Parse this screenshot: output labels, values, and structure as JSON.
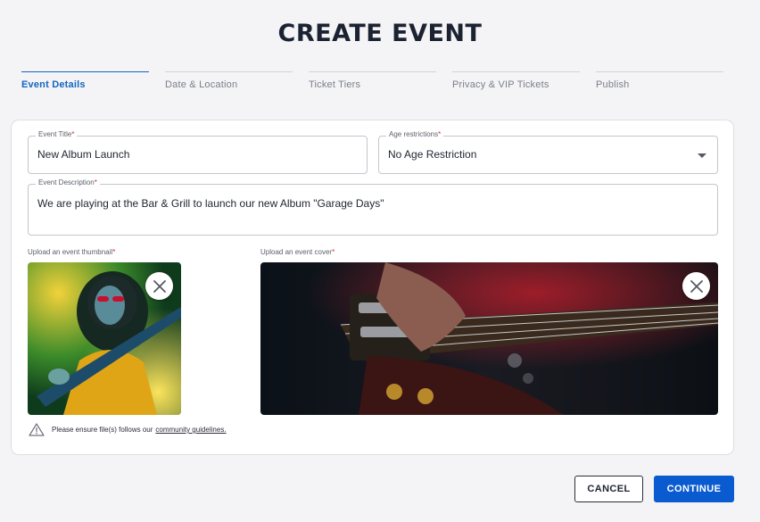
{
  "page": {
    "title": "CREATE EVENT"
  },
  "stepper": {
    "steps": [
      {
        "label": "Event Details",
        "active": true
      },
      {
        "label": "Date & Location",
        "active": false
      },
      {
        "label": "Ticket Tiers",
        "active": false
      },
      {
        "label": "Privacy & VIP Tickets",
        "active": false
      },
      {
        "label": "Publish",
        "active": false
      }
    ]
  },
  "form": {
    "required_mark": "*",
    "event_title": {
      "label": "Event Title",
      "value": "New Album Launch"
    },
    "age_restrictions": {
      "label": "Age restrictions",
      "value": "No Age Restriction"
    },
    "event_description": {
      "label": "Event Description",
      "value": "We are playing at the Bar & Grill to launch our new Album \"Garage Days\""
    },
    "thumbnail": {
      "label": "Upload an event thumbnail"
    },
    "cover": {
      "label": "Upload an event cover"
    },
    "notice": {
      "text": "Please ensure file(s) follows our",
      "link": "community guidelines."
    }
  },
  "actions": {
    "cancel": "CANCEL",
    "continue": "CONTINUE"
  },
  "icons": {
    "close": "close-icon",
    "warning": "warning-triangle-icon",
    "dropdown": "chevron-down-icon"
  },
  "colors": {
    "accent": "#1565c0",
    "primary_button": "#0a5bd0",
    "required": "#d32f2f"
  }
}
